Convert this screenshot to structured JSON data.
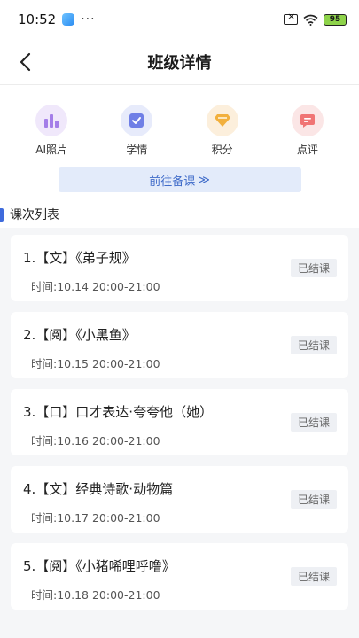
{
  "statusbar": {
    "time": "10:52",
    "dots": "···",
    "battery": "95"
  },
  "header": {
    "title": "班级详情"
  },
  "features": [
    {
      "label": "AI照片",
      "icon": "bar-chart-icon",
      "bg": "#f0e8fb",
      "color": "#a47ee8"
    },
    {
      "label": "学情",
      "icon": "checkbox-icon",
      "bg": "#e7ebfb",
      "color": "#6f7fe6"
    },
    {
      "label": "积分",
      "icon": "diamond-icon",
      "bg": "#fcefdc",
      "color": "#f2b03d"
    },
    {
      "label": "点评",
      "icon": "comment-icon",
      "bg": "#fbe6e6",
      "color": "#f07474"
    }
  ],
  "prep": {
    "label": "前往备课",
    "arrow": "≫"
  },
  "section": {
    "title": "课次列表"
  },
  "courses": [
    {
      "title": "1.【文】《弟子规》",
      "time": "时间:10.14 20:00-21:00",
      "status": "已结课"
    },
    {
      "title": "2.【阅】《小黑鱼》",
      "time": "时间:10.15 20:00-21:00",
      "status": "已结课"
    },
    {
      "title": "3.【口】口才表达·夸夸他（她）",
      "time": "时间:10.16 20:00-21:00",
      "status": "已结课"
    },
    {
      "title": "4.【文】经典诗歌·动物篇",
      "time": "时间:10.17 20:00-21:00",
      "status": "已结课"
    },
    {
      "title": "5.【阅】《小猪唏哩呼噜》",
      "time": "时间:10.18 20:00-21:00",
      "status": "已结课"
    }
  ]
}
